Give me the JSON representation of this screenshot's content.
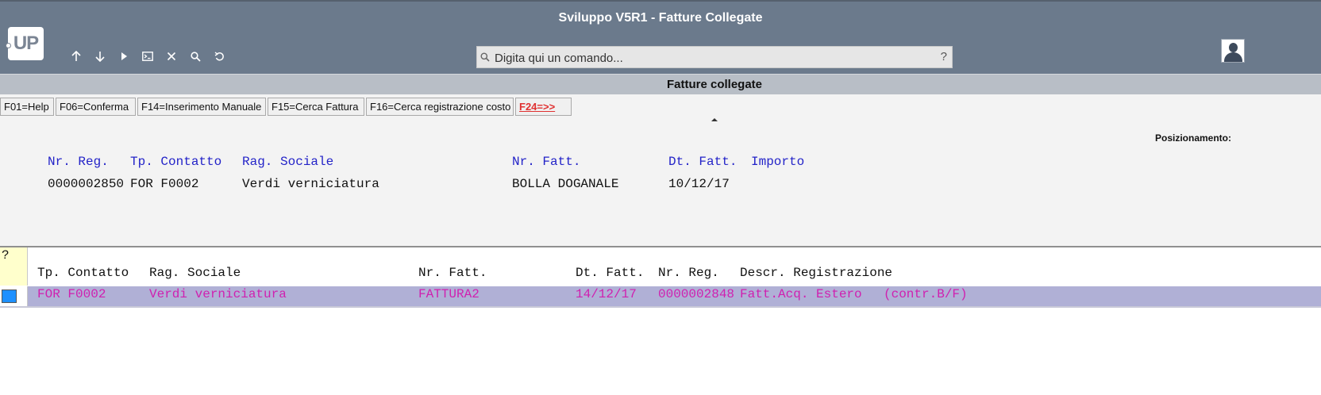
{
  "window": {
    "title": "Sviluppo V5R1 - Fatture Collegate"
  },
  "logo": {
    "text": "UP"
  },
  "toolbar": {
    "icons": [
      "arrow-up-icon",
      "arrow-down-icon",
      "play-icon",
      "terminal-icon",
      "close-icon",
      "search-icon",
      "undo-icon"
    ]
  },
  "command": {
    "placeholder": "Digita qui un comando...",
    "help": "?"
  },
  "subtitle": "Fatture collegate",
  "fkeys": [
    {
      "label": "F01=Help"
    },
    {
      "label": "F06=Conferma"
    },
    {
      "label": "F14=Inserimento Manuale"
    },
    {
      "label": "F15=Cerca Fattura"
    },
    {
      "label": "F16=Cerca registrazione costo"
    },
    {
      "label": "F24=>>"
    }
  ],
  "positioning_label": "Posizionamento:",
  "header_record": {
    "labels": {
      "nr_reg": "Nr. Reg.",
      "tp_contatto": "Tp. Contatto",
      "rag_sociale": "Rag. Sociale",
      "nr_fatt": "Nr. Fatt.",
      "dt_fatt": "Dt. Fatt.",
      "importo": "Importo"
    },
    "values": {
      "nr_reg": "0000002850",
      "tp_contatto": "FOR F0002",
      "rag_sociale": "Verdi verniciatura",
      "nr_fatt": "BOLLA DOGANALE",
      "dt_fatt": "10/12/17"
    }
  },
  "list": {
    "selector_header": "?",
    "columns": {
      "tp_contatto": "Tp. Contatto",
      "rag_sociale": "Rag. Sociale",
      "nr_fatt": "Nr. Fatt.",
      "dt_fatt": "Dt. Fatt.",
      "nr_reg": "Nr. Reg.",
      "descr": "Descr. Registrazione"
    },
    "rows": [
      {
        "tp_contatto": "FOR F0002",
        "rag_sociale": "Verdi verniciatura",
        "nr_fatt": "FATTURA2",
        "dt_fatt": "14/12/17",
        "nr_reg": "0000002848",
        "descr": "Fatt.Acq. Estero",
        "descr_extra": "(contr.B/F)"
      }
    ]
  }
}
